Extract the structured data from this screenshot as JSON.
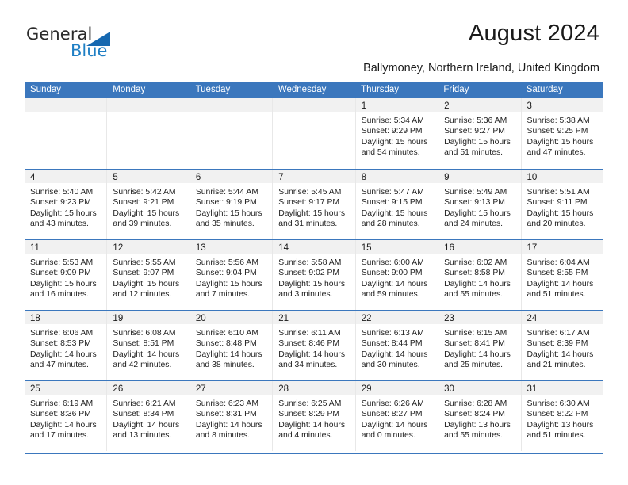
{
  "brand": {
    "name_part1": "General",
    "name_part2": "Blue",
    "triangle_color": "#1668b0",
    "blue_text_color": "#1f7fc4"
  },
  "header": {
    "title": "August 2024",
    "subtitle": "Ballymoney, Northern Ireland, United Kingdom",
    "header_bg": "#3b77bd"
  },
  "weekdays": [
    "Sunday",
    "Monday",
    "Tuesday",
    "Wednesday",
    "Thursday",
    "Friday",
    "Saturday"
  ],
  "weeks": [
    [
      {
        "day": "",
        "sunrise": "",
        "sunset": "",
        "daylight1": "",
        "daylight2": ""
      },
      {
        "day": "",
        "sunrise": "",
        "sunset": "",
        "daylight1": "",
        "daylight2": ""
      },
      {
        "day": "",
        "sunrise": "",
        "sunset": "",
        "daylight1": "",
        "daylight2": ""
      },
      {
        "day": "",
        "sunrise": "",
        "sunset": "",
        "daylight1": "",
        "daylight2": ""
      },
      {
        "day": "1",
        "sunrise": "Sunrise: 5:34 AM",
        "sunset": "Sunset: 9:29 PM",
        "daylight1": "Daylight: 15 hours",
        "daylight2": "and 54 minutes."
      },
      {
        "day": "2",
        "sunrise": "Sunrise: 5:36 AM",
        "sunset": "Sunset: 9:27 PM",
        "daylight1": "Daylight: 15 hours",
        "daylight2": "and 51 minutes."
      },
      {
        "day": "3",
        "sunrise": "Sunrise: 5:38 AM",
        "sunset": "Sunset: 9:25 PM",
        "daylight1": "Daylight: 15 hours",
        "daylight2": "and 47 minutes."
      }
    ],
    [
      {
        "day": "4",
        "sunrise": "Sunrise: 5:40 AM",
        "sunset": "Sunset: 9:23 PM",
        "daylight1": "Daylight: 15 hours",
        "daylight2": "and 43 minutes."
      },
      {
        "day": "5",
        "sunrise": "Sunrise: 5:42 AM",
        "sunset": "Sunset: 9:21 PM",
        "daylight1": "Daylight: 15 hours",
        "daylight2": "and 39 minutes."
      },
      {
        "day": "6",
        "sunrise": "Sunrise: 5:44 AM",
        "sunset": "Sunset: 9:19 PM",
        "daylight1": "Daylight: 15 hours",
        "daylight2": "and 35 minutes."
      },
      {
        "day": "7",
        "sunrise": "Sunrise: 5:45 AM",
        "sunset": "Sunset: 9:17 PM",
        "daylight1": "Daylight: 15 hours",
        "daylight2": "and 31 minutes."
      },
      {
        "day": "8",
        "sunrise": "Sunrise: 5:47 AM",
        "sunset": "Sunset: 9:15 PM",
        "daylight1": "Daylight: 15 hours",
        "daylight2": "and 28 minutes."
      },
      {
        "day": "9",
        "sunrise": "Sunrise: 5:49 AM",
        "sunset": "Sunset: 9:13 PM",
        "daylight1": "Daylight: 15 hours",
        "daylight2": "and 24 minutes."
      },
      {
        "day": "10",
        "sunrise": "Sunrise: 5:51 AM",
        "sunset": "Sunset: 9:11 PM",
        "daylight1": "Daylight: 15 hours",
        "daylight2": "and 20 minutes."
      }
    ],
    [
      {
        "day": "11",
        "sunrise": "Sunrise: 5:53 AM",
        "sunset": "Sunset: 9:09 PM",
        "daylight1": "Daylight: 15 hours",
        "daylight2": "and 16 minutes."
      },
      {
        "day": "12",
        "sunrise": "Sunrise: 5:55 AM",
        "sunset": "Sunset: 9:07 PM",
        "daylight1": "Daylight: 15 hours",
        "daylight2": "and 12 minutes."
      },
      {
        "day": "13",
        "sunrise": "Sunrise: 5:56 AM",
        "sunset": "Sunset: 9:04 PM",
        "daylight1": "Daylight: 15 hours",
        "daylight2": "and 7 minutes."
      },
      {
        "day": "14",
        "sunrise": "Sunrise: 5:58 AM",
        "sunset": "Sunset: 9:02 PM",
        "daylight1": "Daylight: 15 hours",
        "daylight2": "and 3 minutes."
      },
      {
        "day": "15",
        "sunrise": "Sunrise: 6:00 AM",
        "sunset": "Sunset: 9:00 PM",
        "daylight1": "Daylight: 14 hours",
        "daylight2": "and 59 minutes."
      },
      {
        "day": "16",
        "sunrise": "Sunrise: 6:02 AM",
        "sunset": "Sunset: 8:58 PM",
        "daylight1": "Daylight: 14 hours",
        "daylight2": "and 55 minutes."
      },
      {
        "day": "17",
        "sunrise": "Sunrise: 6:04 AM",
        "sunset": "Sunset: 8:55 PM",
        "daylight1": "Daylight: 14 hours",
        "daylight2": "and 51 minutes."
      }
    ],
    [
      {
        "day": "18",
        "sunrise": "Sunrise: 6:06 AM",
        "sunset": "Sunset: 8:53 PM",
        "daylight1": "Daylight: 14 hours",
        "daylight2": "and 47 minutes."
      },
      {
        "day": "19",
        "sunrise": "Sunrise: 6:08 AM",
        "sunset": "Sunset: 8:51 PM",
        "daylight1": "Daylight: 14 hours",
        "daylight2": "and 42 minutes."
      },
      {
        "day": "20",
        "sunrise": "Sunrise: 6:10 AM",
        "sunset": "Sunset: 8:48 PM",
        "daylight1": "Daylight: 14 hours",
        "daylight2": "and 38 minutes."
      },
      {
        "day": "21",
        "sunrise": "Sunrise: 6:11 AM",
        "sunset": "Sunset: 8:46 PM",
        "daylight1": "Daylight: 14 hours",
        "daylight2": "and 34 minutes."
      },
      {
        "day": "22",
        "sunrise": "Sunrise: 6:13 AM",
        "sunset": "Sunset: 8:44 PM",
        "daylight1": "Daylight: 14 hours",
        "daylight2": "and 30 minutes."
      },
      {
        "day": "23",
        "sunrise": "Sunrise: 6:15 AM",
        "sunset": "Sunset: 8:41 PM",
        "daylight1": "Daylight: 14 hours",
        "daylight2": "and 25 minutes."
      },
      {
        "day": "24",
        "sunrise": "Sunrise: 6:17 AM",
        "sunset": "Sunset: 8:39 PM",
        "daylight1": "Daylight: 14 hours",
        "daylight2": "and 21 minutes."
      }
    ],
    [
      {
        "day": "25",
        "sunrise": "Sunrise: 6:19 AM",
        "sunset": "Sunset: 8:36 PM",
        "daylight1": "Daylight: 14 hours",
        "daylight2": "and 17 minutes."
      },
      {
        "day": "26",
        "sunrise": "Sunrise: 6:21 AM",
        "sunset": "Sunset: 8:34 PM",
        "daylight1": "Daylight: 14 hours",
        "daylight2": "and 13 minutes."
      },
      {
        "day": "27",
        "sunrise": "Sunrise: 6:23 AM",
        "sunset": "Sunset: 8:31 PM",
        "daylight1": "Daylight: 14 hours",
        "daylight2": "and 8 minutes."
      },
      {
        "day": "28",
        "sunrise": "Sunrise: 6:25 AM",
        "sunset": "Sunset: 8:29 PM",
        "daylight1": "Daylight: 14 hours",
        "daylight2": "and 4 minutes."
      },
      {
        "day": "29",
        "sunrise": "Sunrise: 6:26 AM",
        "sunset": "Sunset: 8:27 PM",
        "daylight1": "Daylight: 14 hours",
        "daylight2": "and 0 minutes."
      },
      {
        "day": "30",
        "sunrise": "Sunrise: 6:28 AM",
        "sunset": "Sunset: 8:24 PM",
        "daylight1": "Daylight: 13 hours",
        "daylight2": "and 55 minutes."
      },
      {
        "day": "31",
        "sunrise": "Sunrise: 6:30 AM",
        "sunset": "Sunset: 8:22 PM",
        "daylight1": "Daylight: 13 hours",
        "daylight2": "and 51 minutes."
      }
    ]
  ]
}
